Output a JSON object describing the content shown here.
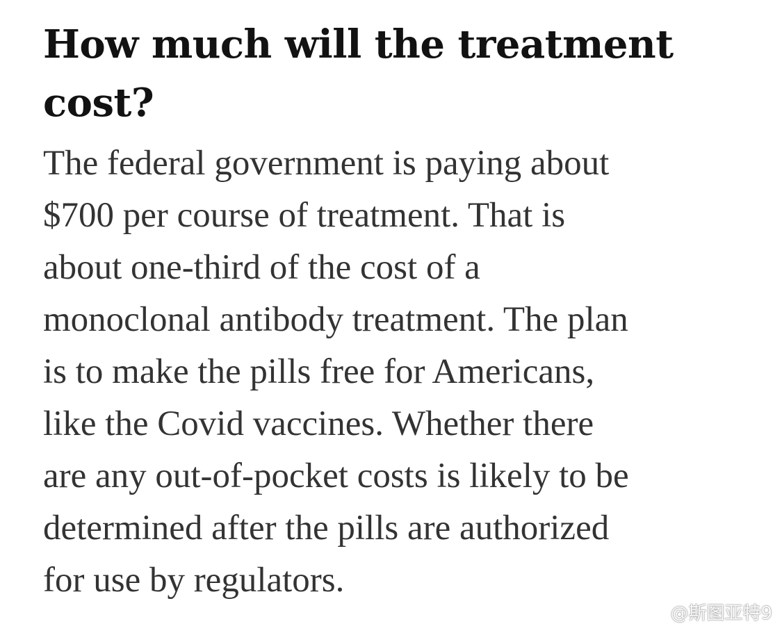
{
  "article": {
    "headline_lines": [
      "How much will the treatment",
      "cost?"
    ],
    "body_lines": [
      "The federal government is paying about",
      "$700 per course of treatment. That is",
      "about one-third of the cost of a",
      "monoclonal antibody treatment. The plan",
      "is to make the pills free for Americans,",
      "like the Covid vaccines. Whether there",
      "are any out-of-pocket costs is likely to be",
      "determined after the pills are authorized",
      "for use by regulators."
    ]
  },
  "watermark": {
    "icon": "weibo-icon",
    "text": "@斯图亚特9"
  }
}
